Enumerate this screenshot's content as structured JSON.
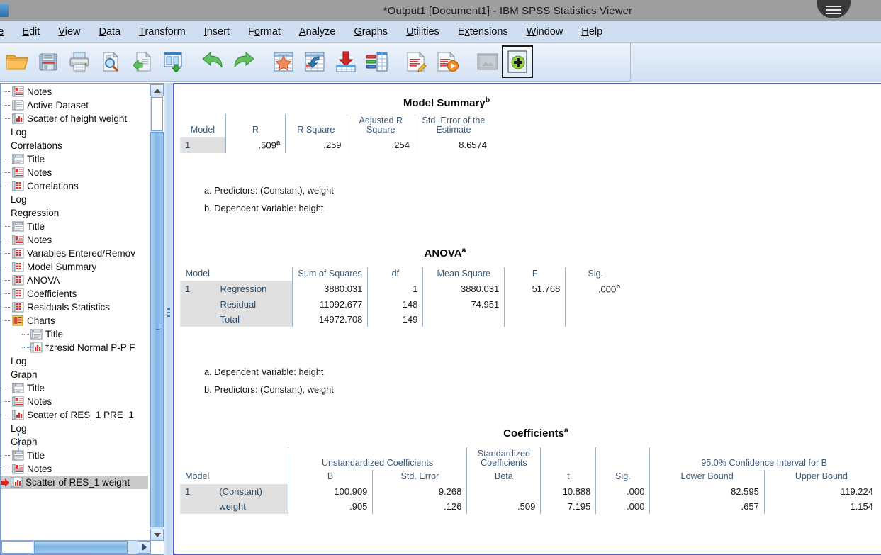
{
  "window": {
    "title": "*Output1 [Document1] - IBM SPSS Statistics Viewer"
  },
  "menubar": {
    "items": [
      {
        "label": "le",
        "icon": "menu-file"
      },
      {
        "label": "Edit",
        "icon": "menu-edit"
      },
      {
        "label": "View",
        "icon": "menu-view"
      },
      {
        "label": "Data",
        "icon": "menu-data"
      },
      {
        "label": "Transform",
        "icon": "menu-transform"
      },
      {
        "label": "Insert",
        "icon": "menu-insert"
      },
      {
        "label": "Format",
        "icon": "menu-format"
      },
      {
        "label": "Analyze",
        "icon": "menu-analyze"
      },
      {
        "label": "Graphs",
        "icon": "menu-graphs"
      },
      {
        "label": "Utilities",
        "icon": "menu-utilities"
      },
      {
        "label": "Extensions",
        "icon": "menu-extensions"
      },
      {
        "label": "Window",
        "icon": "menu-window"
      },
      {
        "label": "Help",
        "icon": "menu-help"
      }
    ]
  },
  "toolbar": {
    "buttons": [
      {
        "name": "open-file-icon"
      },
      {
        "name": "save-icon"
      },
      {
        "name": "print-icon"
      },
      {
        "name": "print-preview-icon"
      },
      {
        "name": "recall-dialogs-icon"
      },
      {
        "name": "export-icon"
      },
      {
        "name": "undo-icon"
      },
      {
        "name": "redo-icon"
      },
      {
        "name": "goto-data-icon"
      },
      {
        "name": "goto-case-icon"
      },
      {
        "name": "insert-footer-icon"
      },
      {
        "name": "variables-icon"
      },
      {
        "name": "run-syntax-edit-icon"
      },
      {
        "name": "run-description-icon"
      },
      {
        "name": "dim-image-icon"
      },
      {
        "name": "add-item-icon"
      }
    ]
  },
  "outline": {
    "nodes": [
      {
        "label": "Notes",
        "icon": "notes-icon",
        "level": 1,
        "selected": false
      },
      {
        "label": "Active Dataset",
        "icon": "dataset-icon",
        "level": 1,
        "selected": false
      },
      {
        "label": "Scatter of height weight",
        "icon": "chart-icon",
        "level": 1,
        "selected": false
      },
      {
        "label": "Log",
        "icon": "none",
        "level": 0,
        "selected": false
      },
      {
        "label": "Correlations",
        "icon": "none",
        "level": 0,
        "selected": false
      },
      {
        "label": "Title",
        "icon": "title-icon",
        "level": 1,
        "selected": false
      },
      {
        "label": "Notes",
        "icon": "notes-icon",
        "level": 1,
        "selected": false
      },
      {
        "label": "Correlations",
        "icon": "table-icon",
        "level": 1,
        "selected": false
      },
      {
        "label": "Log",
        "icon": "none",
        "level": 0,
        "selected": false
      },
      {
        "label": "Regression",
        "icon": "none",
        "level": 0,
        "selected": false
      },
      {
        "label": "Title",
        "icon": "title-icon",
        "level": 1,
        "selected": false
      },
      {
        "label": "Notes",
        "icon": "notes-icon",
        "level": 1,
        "selected": false
      },
      {
        "label": "Variables Entered/Remov",
        "icon": "table-icon",
        "level": 1,
        "selected": false
      },
      {
        "label": "Model Summary",
        "icon": "table-icon",
        "level": 1,
        "selected": false
      },
      {
        "label": "ANOVA",
        "icon": "table-icon",
        "level": 1,
        "selected": false
      },
      {
        "label": "Coefficients",
        "icon": "table-icon",
        "level": 1,
        "selected": false
      },
      {
        "label": "Residuals Statistics",
        "icon": "table-icon",
        "level": 1,
        "selected": false
      },
      {
        "label": "Charts",
        "icon": "charts-folder-icon",
        "level": 1,
        "selected": false
      },
      {
        "label": "Title",
        "icon": "title-icon",
        "level": 2,
        "selected": false
      },
      {
        "label": "*zresid Normal P-P F",
        "icon": "chart-icon",
        "level": 2,
        "selected": false
      },
      {
        "label": "Log",
        "icon": "none",
        "level": 0,
        "selected": false
      },
      {
        "label": "Graph",
        "icon": "none",
        "level": 0,
        "selected": false
      },
      {
        "label": "Title",
        "icon": "title-icon",
        "level": 1,
        "selected": false
      },
      {
        "label": "Notes",
        "icon": "notes-icon",
        "level": 1,
        "selected": false
      },
      {
        "label": "Scatter of RES_1 PRE_1",
        "icon": "chart-icon",
        "level": 1,
        "selected": false
      },
      {
        "label": "Log",
        "icon": "none",
        "level": 0,
        "selected": false
      },
      {
        "label": "Graph",
        "icon": "none",
        "level": 0,
        "selected": false
      },
      {
        "label": "Title",
        "icon": "title-icon",
        "level": 1,
        "selected": false
      },
      {
        "label": "Notes",
        "icon": "notes-icon",
        "level": 1,
        "selected": false
      },
      {
        "label": "Scatter of RES_1 weight",
        "icon": "chart-icon",
        "level": 1,
        "selected": true
      }
    ]
  },
  "output": {
    "model_summary": {
      "title": "Model Summary",
      "title_sup": "b",
      "headers": [
        "Model",
        "R",
        "R Square",
        "Adjusted R Square",
        "Std. Error of the Estimate"
      ],
      "rows": [
        {
          "model": "1",
          "R": ".509",
          "R_sup": "a",
          "r_square": ".259",
          "adj_r_square": ".254",
          "std_error": "8.6574"
        }
      ],
      "footnotes": [
        "a. Predictors: (Constant), weight",
        "b. Dependent Variable: height"
      ]
    },
    "anova": {
      "title": "ANOVA",
      "title_sup": "a",
      "headers": [
        "Model",
        "",
        "Sum of Squares",
        "df",
        "Mean Square",
        "F",
        "Sig."
      ],
      "rows": [
        {
          "model": "1",
          "source": "Regression",
          "ss": "3880.031",
          "df": "1",
          "ms": "3880.031",
          "f": "51.768",
          "sig": ".000",
          "sig_sup": "b"
        },
        {
          "model": "",
          "source": "Residual",
          "ss": "11092.677",
          "df": "148",
          "ms": "74.951",
          "f": "",
          "sig": "",
          "sig_sup": ""
        },
        {
          "model": "",
          "source": "Total",
          "ss": "14972.708",
          "df": "149",
          "ms": "",
          "f": "",
          "sig": "",
          "sig_sup": ""
        }
      ],
      "footnotes": [
        "a. Dependent Variable: height",
        "b. Predictors: (Constant), weight"
      ]
    },
    "coefficients": {
      "title": "Coefficients",
      "title_sup": "a",
      "group_headers": [
        "Unstandardized Coefficients",
        "Standardized Coefficients",
        "95.0% Confidence Interval for B"
      ],
      "headers": [
        "Model",
        "",
        "B",
        "Std. Error",
        "Beta",
        "t",
        "Sig.",
        "Lower Bound",
        "Upper Bound"
      ],
      "rows": [
        {
          "model": "1",
          "var": "(Constant)",
          "b": "100.909",
          "se": "9.268",
          "beta": "",
          "t": "10.888",
          "sig": ".000",
          "lower": "82.595",
          "upper": "119.224"
        },
        {
          "model": "",
          "var": "weight",
          "b": ".905",
          "se": ".126",
          "beta": ".509",
          "t": "7.195",
          "sig": ".000",
          "lower": ".657",
          "upper": "1.154"
        }
      ]
    }
  },
  "colors": {
    "titlebar": "#9c9ea0",
    "menubar": "#cfdef0",
    "toolbar_top": "#eef4fc",
    "toolbar_bottom": "#d3e2f4",
    "pane_border": "#5c5ccc",
    "table_header_text": "#3b5a78",
    "row_label_bg": "#e0e0e0",
    "selection_bg": "#c9c9c9",
    "scrollbar_thumb": "#7fb3e6"
  }
}
